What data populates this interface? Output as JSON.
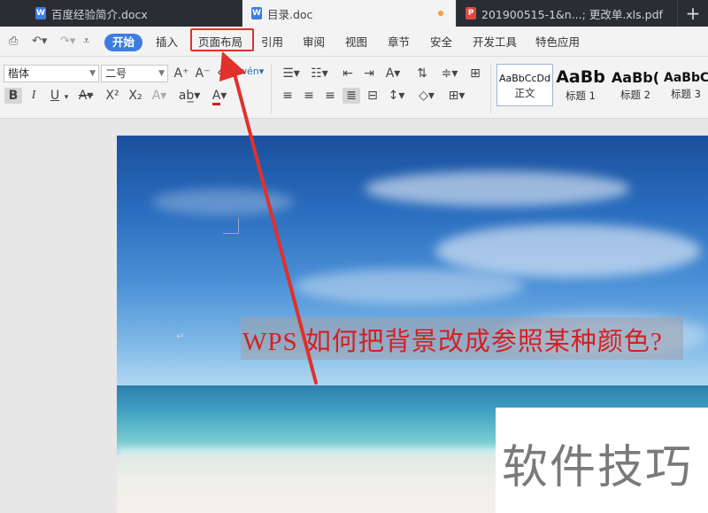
{
  "tabs": [
    {
      "label": "百度经验简介.docx",
      "icon": "W",
      "active": false
    },
    {
      "label": "目录.doc",
      "icon": "W",
      "active": true
    },
    {
      "label": "201900515-1&n...; 更改单.xls.pdf",
      "icon": "P",
      "active": false
    }
  ],
  "new_tab_label": "+",
  "menu": {
    "items": [
      "开始",
      "插入",
      "页面布局",
      "引用",
      "审阅",
      "视图",
      "章节",
      "安全",
      "开发工具",
      "特色应用"
    ],
    "active": "开始",
    "highlighted": "页面布局"
  },
  "toolbar": {
    "font_name": "楷体",
    "font_size": "二号",
    "bold": "B",
    "italic": "I",
    "underline": "U",
    "superscript": "X²",
    "subscript": "X₂",
    "grow_font": "A⁺",
    "shrink_font": "A⁻",
    "font_color": "A",
    "styles": [
      {
        "sample": "AaBbCcDd",
        "name": "正文"
      },
      {
        "sample": "AaBb",
        "name": "标题 1"
      },
      {
        "sample": "AaBb(",
        "name": "标题 2"
      },
      {
        "sample": "AaBbC",
        "name": "标题 3"
      }
    ]
  },
  "document": {
    "headline": "WPS 如何把背景改成参照某种颜色?",
    "watermark": "软件技巧"
  },
  "colors": {
    "accent": "#3d7de0",
    "highlight_red": "#e0312a",
    "headline_red": "#d42020"
  }
}
